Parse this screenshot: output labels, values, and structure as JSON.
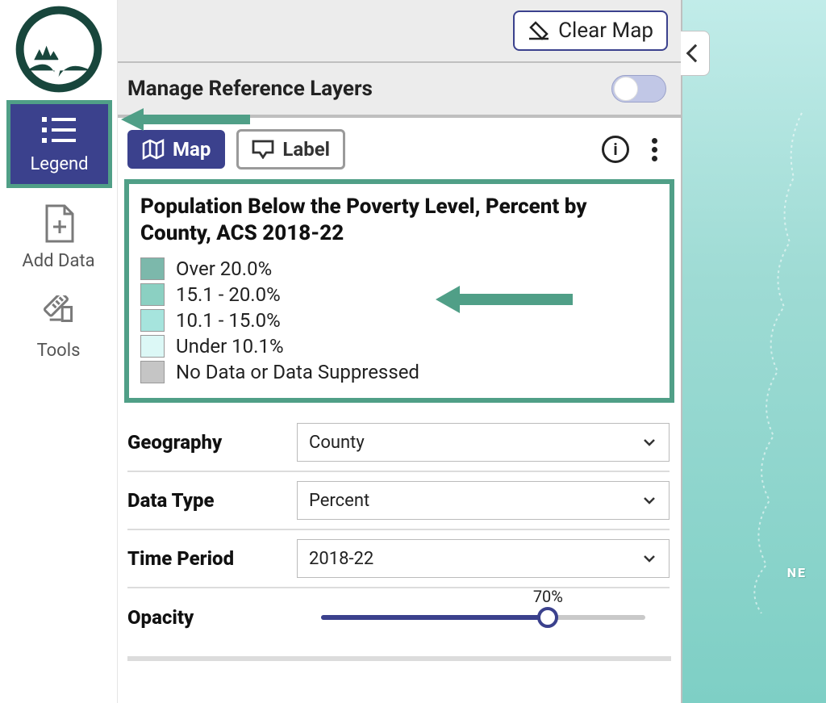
{
  "nav": {
    "legend_label": "Legend",
    "add_data_label": "Add Data",
    "tools_label": "Tools"
  },
  "toolbar": {
    "clear_map": "Clear Map"
  },
  "reference_layers": {
    "title": "Manage Reference Layers",
    "enabled": false
  },
  "tabs": {
    "map": "Map",
    "label": "Label"
  },
  "legend": {
    "title": "Population Below the Poverty Level, Percent by County, ACS 2018-22",
    "items": [
      {
        "color": "#7cb8ab",
        "label": "Over 20.0%"
      },
      {
        "color": "#8bd0c2",
        "label": "15.1 - 20.0%"
      },
      {
        "color": "#a6e4dd",
        "label": "10.1 - 15.0%"
      },
      {
        "color": "#dcf8f6",
        "label": "Under 10.1%"
      },
      {
        "color": "#c5c5c5",
        "label": "No Data or Data Suppressed"
      }
    ]
  },
  "controls": {
    "geography": {
      "label": "Geography",
      "value": "County"
    },
    "data_type": {
      "label": "Data Type",
      "value": "Percent"
    },
    "time_period": {
      "label": "Time Period",
      "value": "2018-22"
    },
    "opacity": {
      "label": "Opacity",
      "value": 70,
      "display": "70%"
    }
  },
  "map": {
    "place_label": "NE"
  },
  "colors": {
    "primary": "#3b418d",
    "highlight": "#509f87"
  }
}
